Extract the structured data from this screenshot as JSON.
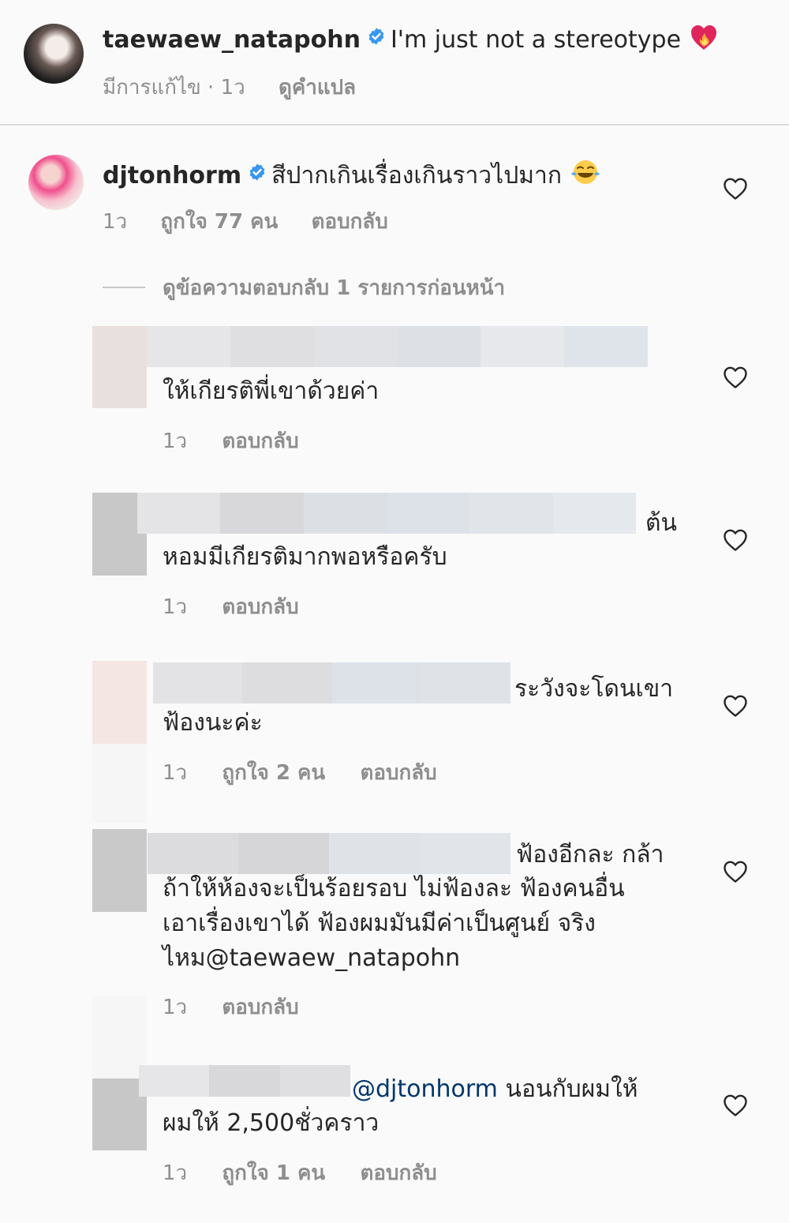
{
  "post": {
    "username": "taewaew_natapohn",
    "caption": "I'm just not a stereotype",
    "meta_edited": "มีการแก้ไข · 1ว",
    "meta_translate": "ดูคำแปล"
  },
  "top_comment": {
    "username": "djtonhorm",
    "text": "สีปากเกินเรื่องเกินราวไปมาก",
    "time": "1ว",
    "likes": "ถูกใจ 77 คน",
    "reply": "ตอบกลับ"
  },
  "view_previous_replies": "ดูข้อความตอบกลับ 1 รายการก่อนหน้า",
  "replies": [
    {
      "lines": [
        "ให้เกียรติพี่เขาด้วยค่า"
      ],
      "time": "1ว",
      "reply": "ตอบกลับ"
    },
    {
      "line_tail": "ต้น",
      "lines": [
        "หอมมีเกียรติมากพอหรือครับ"
      ],
      "time": "1ว",
      "reply": "ตอบกลับ"
    },
    {
      "line_tail": "ระวังจะโดนเขา",
      "lines": [
        "ฟ้องนะค่ะ"
      ],
      "time": "1ว",
      "likes": "ถูกใจ 2 คน",
      "reply": "ตอบกลับ"
    },
    {
      "line_tail": "ฟ้องอีกละ กล้า",
      "lines": [
        "ถ้าให้ห้องจะเป็นร้อยรอบ ไม่ฟ้องละ ฟ้องคนอื่น",
        "เอาเรื่องเขาได้ ฟ้องผมมันมีค่าเป็นศูนย์ จริง",
        "ไหม@taewaew_natapohn"
      ],
      "time": "1ว",
      "reply": "ตอบกลับ"
    },
    {
      "mention": "@djtonhorm",
      "line_tail": "นอนกับผมให้",
      "lines": [
        "ผมให้ 2,500ชั่วคราว"
      ],
      "time": "1ว",
      "likes": "ถูกใจ 1 คน",
      "reply": "ตอบกลับ"
    }
  ],
  "icons": [
    "verified-badge-icon",
    "heart-icon",
    "heart-fire-emoji",
    "laughing-tears-emoji"
  ],
  "colors": {
    "background": "#fafafa",
    "text": "#262626",
    "muted": "#8e8e8e",
    "verified": "#3897f0",
    "mention": "#00376b"
  }
}
